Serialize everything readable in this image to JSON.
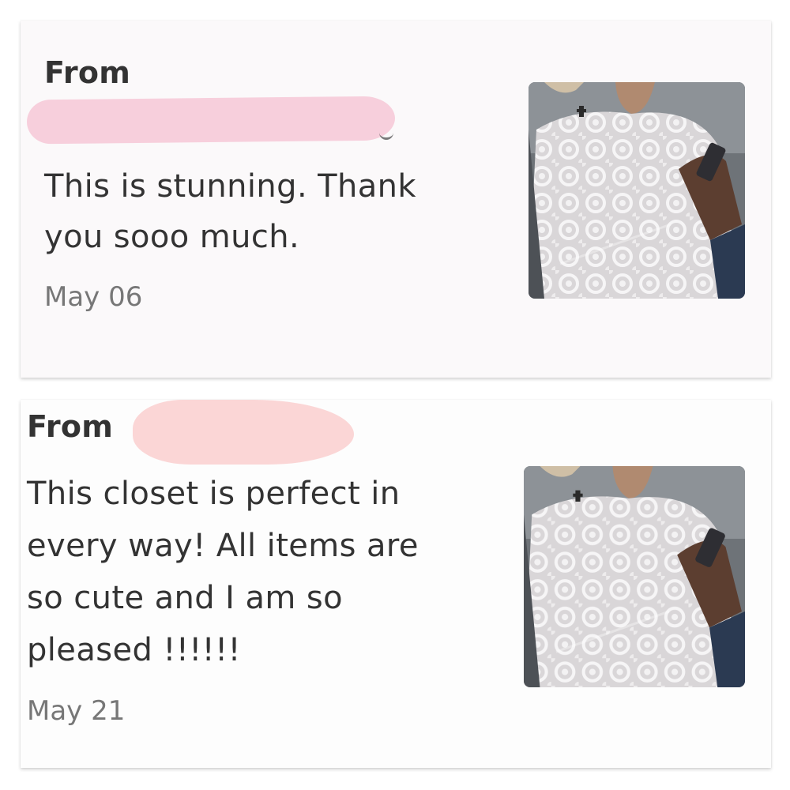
{
  "reviews": [
    {
      "from_label": "From",
      "message": "This is stunning. Thank\nyou sooo much.",
      "date": "May 06",
      "image": "lace-blouse-photo"
    },
    {
      "from_label": "From",
      "message": "This closet is perfect in\nevery way! All items are\nso cute and I am so\npleased !!!!!!",
      "date": "May 21",
      "image": "lace-blouse-photo"
    }
  ],
  "colors": {
    "card_background": "#fbf9fa",
    "text": "#333333",
    "date_text": "#777777",
    "redaction_pink": "#f7cfdc",
    "redaction_peach": "#fbd6d6"
  }
}
